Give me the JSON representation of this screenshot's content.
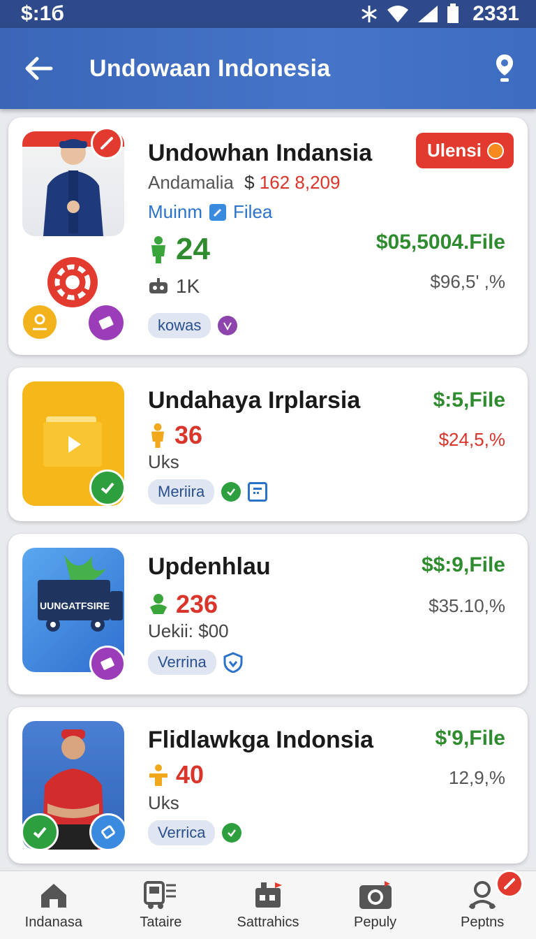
{
  "status": {
    "time": "$:1б",
    "clock": "2331"
  },
  "header": {
    "title": "Undowaan Indonesia"
  },
  "cards": [
    {
      "title": "Undowhan Indansia",
      "subtitle_label": "Andamalia",
      "subtitle_currency": "$",
      "subtitle_value": "162 8,209",
      "link_left": "Muinm",
      "link_right": "Filea",
      "stat": "24",
      "count_label": "1K",
      "tag": "kowas",
      "badge": "Ulensi",
      "price": "$05,5004.File",
      "pct": "$96,5' ,%"
    },
    {
      "title": "Undahaya Irplarsia",
      "stat": "36",
      "meta": "Uks",
      "tag": "Meriira",
      "price": "$:5,File",
      "pct": "$24,5,%"
    },
    {
      "title": "Updenhlau",
      "thumb_text": "UUNGATFSIRE",
      "stat": "236",
      "meta": "Uekii: $00",
      "tag": "Verrina",
      "price": "$$:9,File",
      "pct": "$35.10,%"
    },
    {
      "title": "Flidlawkga Indonsia",
      "stat": "40",
      "meta": "Uks",
      "tag": "Verrica",
      "price": "$'9,File",
      "pct": "12,9,%"
    }
  ],
  "nav": [
    {
      "label": "Indanasa",
      "icon": "home-icon"
    },
    {
      "label": "Tataire",
      "icon": "bus-icon"
    },
    {
      "label": "Sattrahics",
      "icon": "store-icon"
    },
    {
      "label": "Pepuly",
      "icon": "camera-icon"
    },
    {
      "label": "Peptns",
      "icon": "profile-icon"
    }
  ],
  "colors": {
    "app_bar": "#4574c8",
    "price_green": "#2e8b2e",
    "stat_red": "#d9352b",
    "badge_red": "#e23a2e"
  }
}
